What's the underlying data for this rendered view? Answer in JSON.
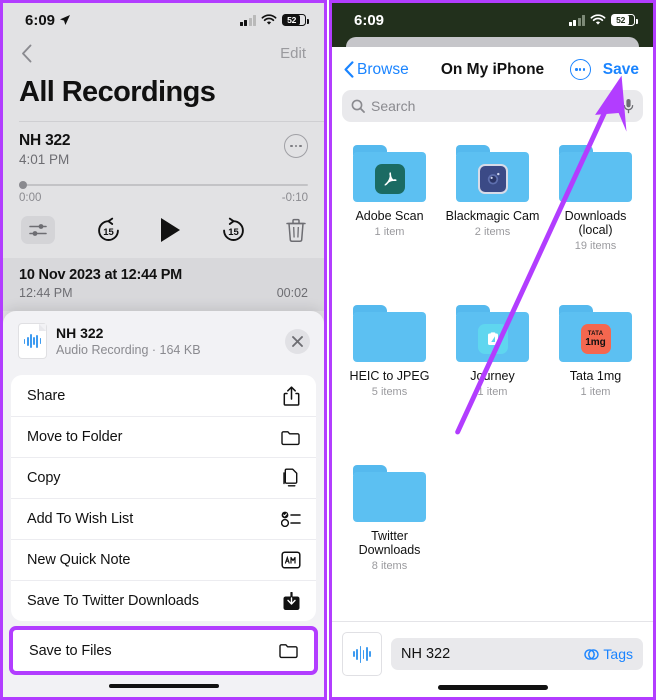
{
  "left_phone": {
    "status_bar": {
      "time": "6:09",
      "location_icon": "location-arrow-icon",
      "signal_icon": "cellular-bars-icon",
      "wifi_icon": "wifi-icon",
      "battery_level": "52"
    },
    "nav": {
      "back_icon": "chevron-left-icon",
      "edit_label": "Edit"
    },
    "page_title": "All Recordings",
    "selected_recording": {
      "name": "NH 322",
      "time": "4:01 PM",
      "more_icon": "ellipsis-circle-icon",
      "scrub_start": "0:00",
      "scrub_end": "-0:10",
      "controls": {
        "eq_icon": "equalizer-icon",
        "back15_label": "15",
        "play_icon": "play-icon",
        "forward15_label": "15",
        "trash_icon": "trash-icon"
      }
    },
    "list_item": {
      "title": "10 Nov 2023 at 12:44 PM",
      "time": "12:44 PM",
      "duration": "00:02"
    },
    "share_sheet": {
      "file_name": "NH 322",
      "file_meta": "Audio Recording · 164 KB",
      "file_icon": "audio-waveform-file-icon",
      "close_icon": "close-x-icon",
      "actions": [
        {
          "label": "Share",
          "icon": "share-up-arrow-icon"
        },
        {
          "label": "Move to Folder",
          "icon": "folder-icon"
        },
        {
          "label": "Copy",
          "icon": "copy-pages-icon"
        },
        {
          "label": "Add To Wish List",
          "icon": "checklist-icon"
        },
        {
          "label": "New Quick Note",
          "icon": "quick-note-icon"
        },
        {
          "label": "Save To Twitter Downloads",
          "icon": "download-box-icon"
        }
      ],
      "highlighted_action": {
        "label": "Save to Files",
        "icon": "folder-icon"
      }
    }
  },
  "right_phone": {
    "status_bar": {
      "time": "6:09",
      "signal_icon": "cellular-bars-icon",
      "wifi_icon": "wifi-icon",
      "battery_level": "52"
    },
    "nav": {
      "back_label": "Browse",
      "back_icon": "chevron-left-icon",
      "title": "On My iPhone",
      "more_icon": "ellipsis-circle-icon",
      "save_label": "Save"
    },
    "search": {
      "placeholder": "Search",
      "search_icon": "magnifier-icon",
      "mic_icon": "microphone-icon"
    },
    "folders": [
      {
        "name": "Adobe Scan",
        "count": "1 item",
        "badge": "adobe-acrobat-icon"
      },
      {
        "name": "Blackmagic Cam",
        "count": "2 items",
        "badge": "blackmagic-camera-icon"
      },
      {
        "name": "Downloads (local)",
        "count": "19 items",
        "badge": "none"
      },
      {
        "name": "HEIC to JPEG",
        "count": "5 items",
        "badge": "none"
      },
      {
        "name": "Journey",
        "count": "1 item",
        "badge": "journey-app-icon"
      },
      {
        "name": "Tata 1mg",
        "count": "1 item",
        "badge": "tata-1mg-icon",
        "badge_text_top": "TATA",
        "badge_text_bottom": "1mg"
      },
      {
        "name": "Twitter Downloads",
        "count": "8 items",
        "badge": "none"
      }
    ],
    "bottom_bar": {
      "file_icon": "audio-waveform-icon",
      "file_name": "NH 322",
      "tags_label": "Tags",
      "tags_icon": "tags-circles-icon"
    }
  },
  "annotations": {
    "arrow_color": "#b23dff",
    "highlight_color": "#b23dff"
  }
}
